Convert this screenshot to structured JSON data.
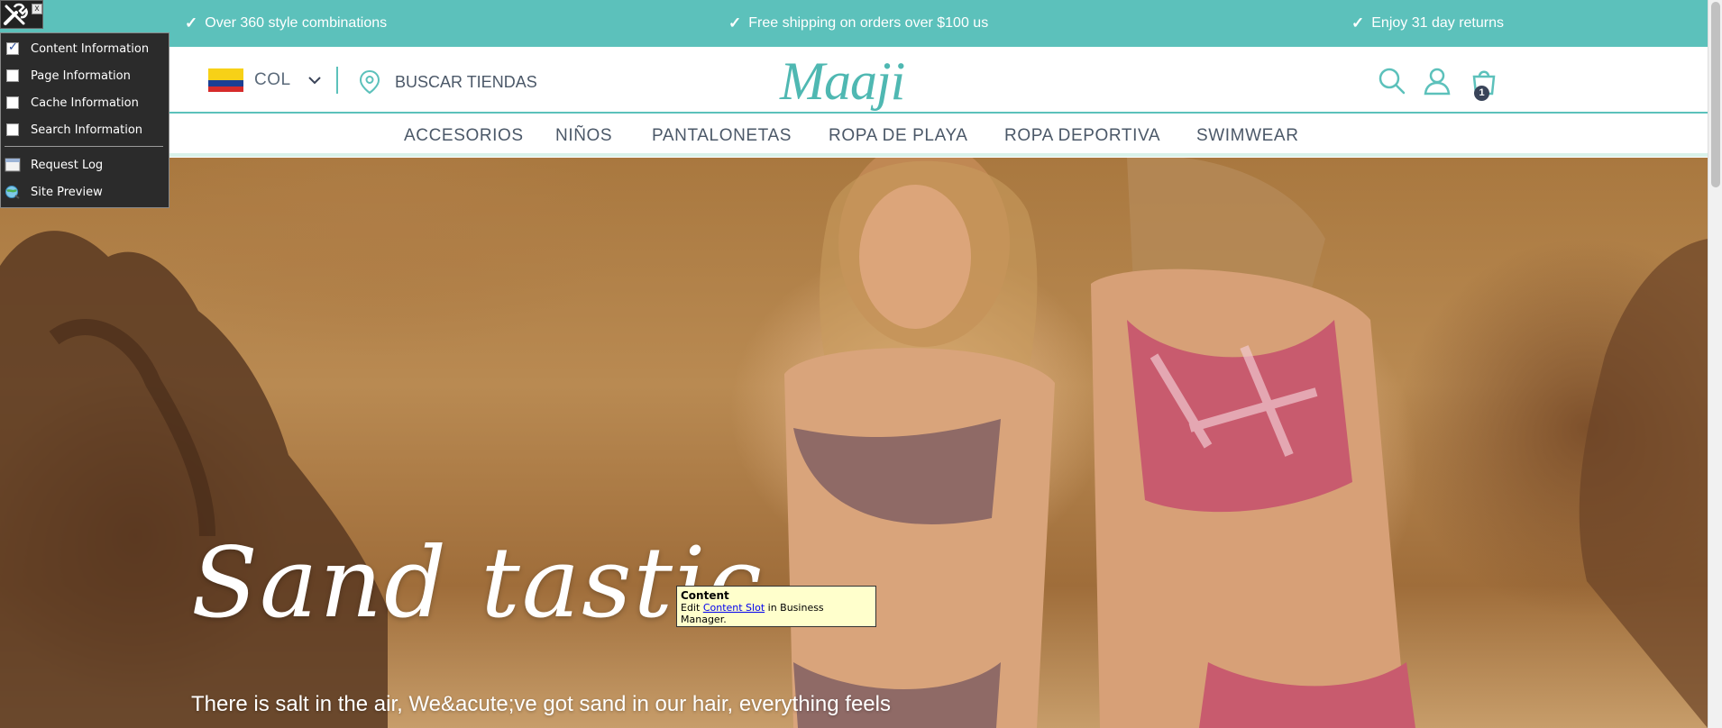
{
  "promo_bar": {
    "items": [
      "Over 360 style combinations",
      "Free shipping on orders over $100 us",
      "Enjoy 31 day returns"
    ]
  },
  "header": {
    "country_code": "COL",
    "stores_label": "BUSCAR TIENDAS",
    "logo_text": "Maaji",
    "cart_count": "1"
  },
  "nav": {
    "items": [
      "ACCESORIOS",
      "NIÑOS",
      "PANTALONETAS",
      "ROPA DE PLAYA",
      "ROPA DEPORTIVA",
      "SWIMWEAR"
    ]
  },
  "hero": {
    "title": "Sand tastic",
    "text": "There is salt in the air, We&acute;ve got sand in our hair, everything feels"
  },
  "tooltip": {
    "title": "Content",
    "prefix": "Edit ",
    "link": "Content Slot",
    "suffix": " in Business Manager."
  },
  "debug_menu": {
    "close": "x",
    "items": [
      {
        "label": "Content Information",
        "checked": true
      },
      {
        "label": "Page Information",
        "checked": false
      },
      {
        "label": "Cache Information",
        "checked": false
      },
      {
        "label": "Search Information",
        "checked": false
      },
      {
        "label": "Request Log"
      },
      {
        "label": "Site Preview"
      }
    ]
  },
  "colors": {
    "brand_teal": "#5cc1bb",
    "text_slate": "#4b5868",
    "badge_dark": "#3a4459",
    "tooltip_bg": "#ffffcc"
  },
  "icons": [
    "check-icon",
    "colombia-flag-icon",
    "chevron-down-icon",
    "location-pin-icon",
    "search-icon",
    "user-icon",
    "shopping-bag-icon",
    "tools-icon",
    "close-icon",
    "request-log-icon",
    "site-preview-icon"
  ]
}
